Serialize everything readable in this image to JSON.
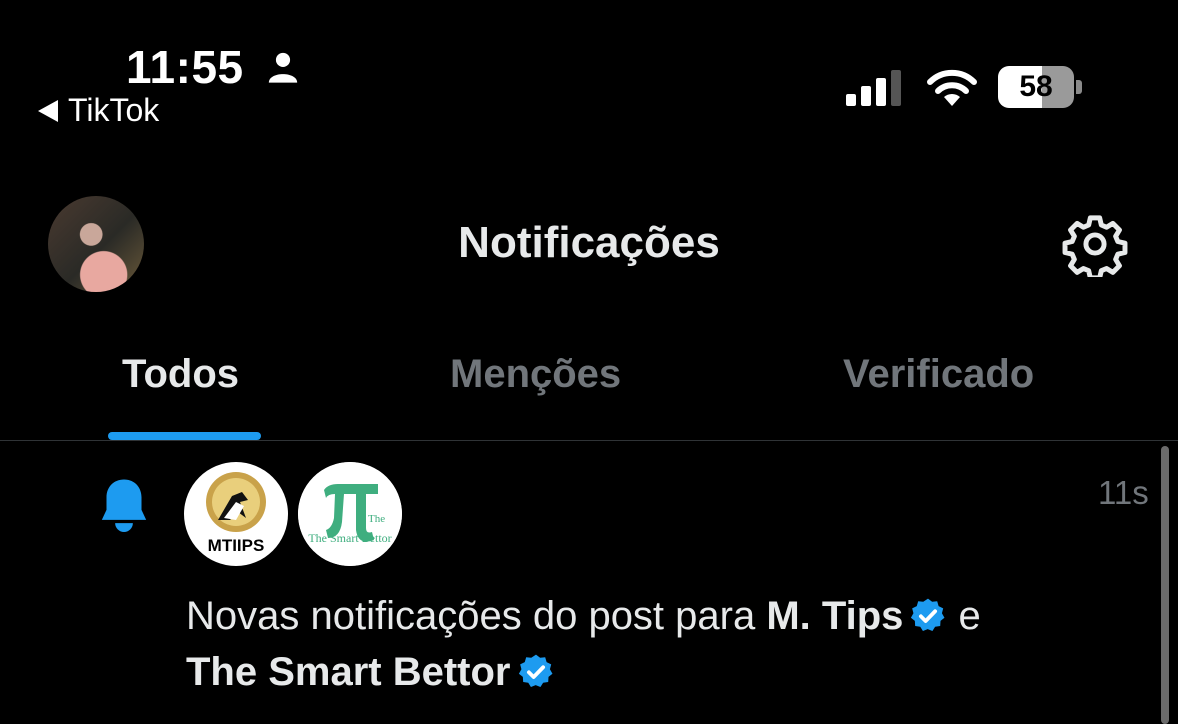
{
  "status_bar": {
    "time": "11:55",
    "back_app": "TikTok",
    "battery": "58",
    "battery_fraction": 0.58
  },
  "header": {
    "title": "Notificações"
  },
  "tabs": [
    {
      "label": "Todos",
      "active": true
    },
    {
      "label": "Menções",
      "active": false
    },
    {
      "label": "Verificado",
      "active": false
    }
  ],
  "notification": {
    "time_ago": "11s",
    "text_prefix": "Novas notificações do post para",
    "account_1": "M. Tips",
    "connector": "e",
    "account_2": "The Smart Bettor",
    "avatar_1_text": "MTIIPS",
    "avatar_2_text": "The Smart Bettor"
  },
  "colors": {
    "accent": "#1d9bf0",
    "background": "#000000",
    "text_primary": "#e7e9ea",
    "text_secondary": "#71767b",
    "avatar_2_green": "#3fae7f"
  },
  "icons": [
    "person-icon",
    "wifi-icon",
    "gear-icon",
    "bell-icon",
    "verified-icon"
  ]
}
